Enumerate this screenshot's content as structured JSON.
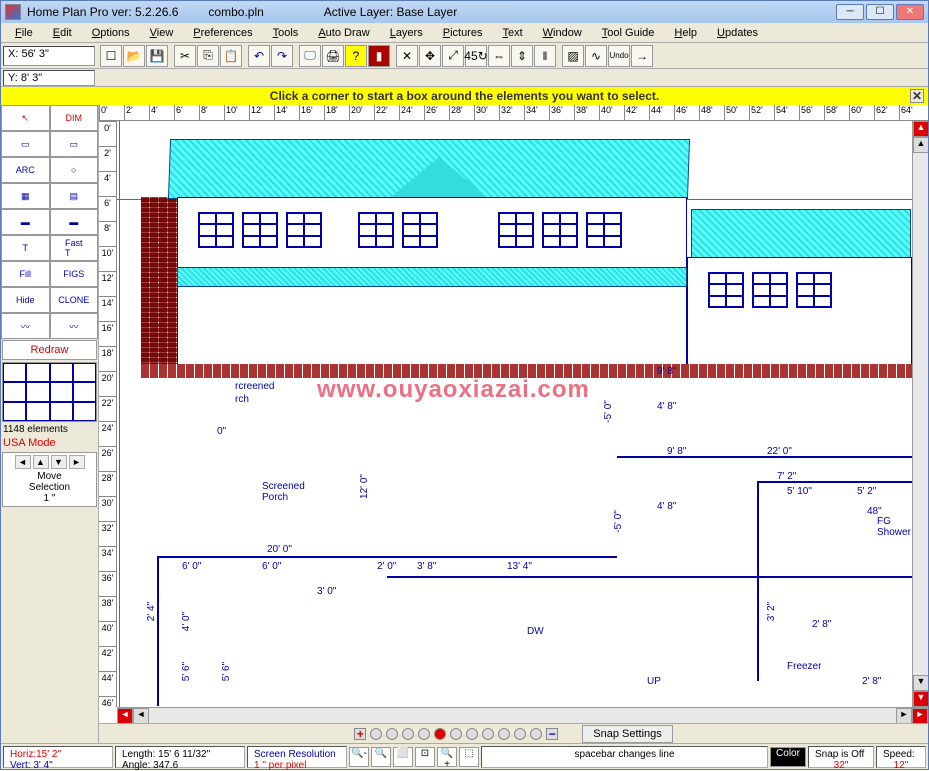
{
  "titlebar": {
    "app": "Home Plan Pro ver: 5.2.26.6",
    "file": "combo.pln",
    "layer": "Active Layer: Base Layer"
  },
  "menus": [
    "File",
    "Edit",
    "Options",
    "View",
    "Preferences",
    "Tools",
    "Auto Draw",
    "Layers",
    "Pictures",
    "Text",
    "Window",
    "Tool Guide",
    "Help",
    "Updates"
  ],
  "coords": {
    "x": "X: 56' 3\"",
    "y": "Y: 8' 3\""
  },
  "banner": "Click a corner to start a box around the elements you want to select.",
  "ruler_h": [
    "0'",
    "2'",
    "4'",
    "6'",
    "8'",
    "10'",
    "12'",
    "14'",
    "16'",
    "18'",
    "20'",
    "22'",
    "24'",
    "26'",
    "28'",
    "30'",
    "32'",
    "34'",
    "36'",
    "38'",
    "40'",
    "42'",
    "44'",
    "46'",
    "48'",
    "50'",
    "52'",
    "54'",
    "56'",
    "58'",
    "60'",
    "62'",
    "64'"
  ],
  "ruler_v": [
    "0'",
    "2'",
    "4'",
    "6'",
    "8'",
    "10'",
    "12'",
    "14'",
    "16'",
    "18'",
    "20'",
    "22'",
    "24'",
    "26'",
    "28'",
    "30'",
    "32'",
    "34'",
    "36'",
    "38'",
    "40'",
    "42'",
    "44'",
    "46'"
  ],
  "tools": {
    "redraw": "Redraw",
    "elements": "1148 elements",
    "mode": "USA Mode",
    "move_label": "Move",
    "move_sel": "Selection",
    "move_dist": "1 \"",
    "labels": [
      "",
      "DIM",
      "",
      "",
      "ARC",
      "",
      "",
      "",
      "",
      "",
      "T",
      "Fast T",
      "Fill",
      "FIGS",
      "Hide",
      "CLONE",
      "",
      ""
    ]
  },
  "plan": {
    "screened": "Screened\nPorch",
    "dims": {
      "d98": "9' 8\"",
      "d48": "4' 8\"",
      "d50": "-5' 0\"",
      "d220": "22' 0\"",
      "d72": "7' 2\"",
      "d510": "5' 10\"",
      "d52": "5' 2\"",
      "d200": "20' 0\"",
      "d60": "6' 0\"",
      "d20": "2' 0\"",
      "d38": "3' 8\"",
      "d134": "13' 4\"",
      "d120": "12' 0\"",
      "d30": "3' 0\"",
      "d24": "2' 4\"",
      "d40": "4' 0\"",
      "d56": "5' 6\"",
      "d28": "2' 8\"",
      "d32": "3' 2\"",
      "d48b": "48\"",
      "d0": "0\""
    },
    "dw": "DW",
    "up": "UP",
    "freezer": "Freezer",
    "rcreened": "rcreened",
    "rch": "rch",
    "shower": "FG Shower"
  },
  "watermark": "www.ouyaoxiazai.com",
  "status": {
    "horiz": "Horiz:15' 2\"",
    "vert": "Vert: 3' 4\"",
    "length": "Length: 15' 6 11/32\"",
    "angle": "Angle: 347.6",
    "res_label": "Screen Resolution",
    "res_val": "1 \" per pixel",
    "hint": "spacebar changes line",
    "color": "Color",
    "snap": "Snap is Off",
    "snap_val": "32\"",
    "speed": "Speed:",
    "speed_val": "12\"",
    "snap_settings": "Snap Settings"
  }
}
